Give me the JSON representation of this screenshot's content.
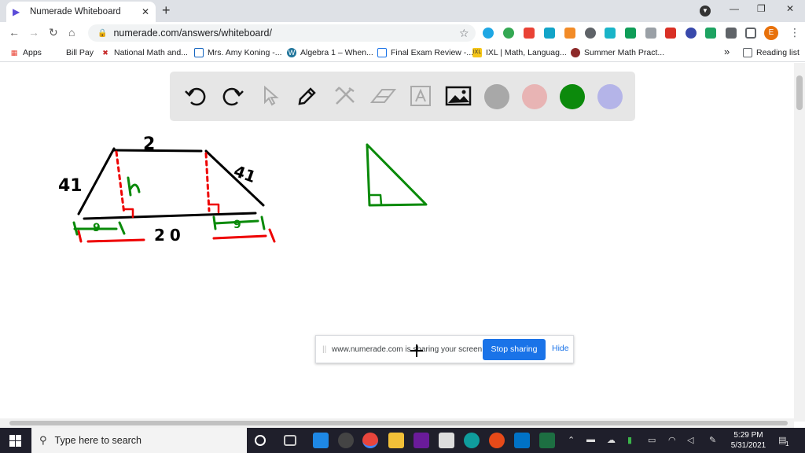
{
  "browser": {
    "tab_title": "Numerade Whiteboard",
    "tab_close": "✕",
    "new_tab": "+",
    "url": "numerade.com/answers/whiteboard/",
    "profile_initial": "E"
  },
  "bookmarks": [
    {
      "label": "Apps",
      "icon": "apps-grid-icon"
    },
    {
      "label": "Bill Pay",
      "icon": "blank-page-icon"
    },
    {
      "label": "National Math and...",
      "icon": "x-logo-icon"
    },
    {
      "label": "Mrs. Amy Koning -...",
      "icon": "site-icon"
    },
    {
      "label": "Algebra 1 – When...",
      "icon": "wordpress-icon"
    },
    {
      "label": "Final Exam Review -...",
      "icon": "page-icon"
    },
    {
      "label": "IXL | Math, Languag...",
      "icon": "ixl-icon"
    },
    {
      "label": "Summer Math Pract...",
      "icon": "circle-logo-icon"
    }
  ],
  "bookmarks_overflow": "»",
  "reading_list": "Reading list",
  "whiteboard": {
    "tools": [
      "undo-icon",
      "redo-icon",
      "pointer-icon",
      "pen-icon",
      "tools-icon",
      "eraser-icon",
      "text-icon",
      "image-icon"
    ],
    "colors": [
      "#a8a8a8",
      "#e8b4b4",
      "#0c8a0c",
      "#b4b4e8"
    ],
    "drawing_labels": {
      "top": "2",
      "left": "41",
      "right": "41",
      "height": "h",
      "bottom": "20",
      "seg_left": "9",
      "seg_right": "9"
    }
  },
  "share_bar": {
    "message": "www.numerade.com is sharing your screen.",
    "stop_label": "Stop sharing",
    "hide_label": "Hide"
  },
  "taskbar": {
    "search_placeholder": "Type here to search",
    "time": "5:29 PM",
    "date": "5/31/2021",
    "notification_count": "1"
  }
}
